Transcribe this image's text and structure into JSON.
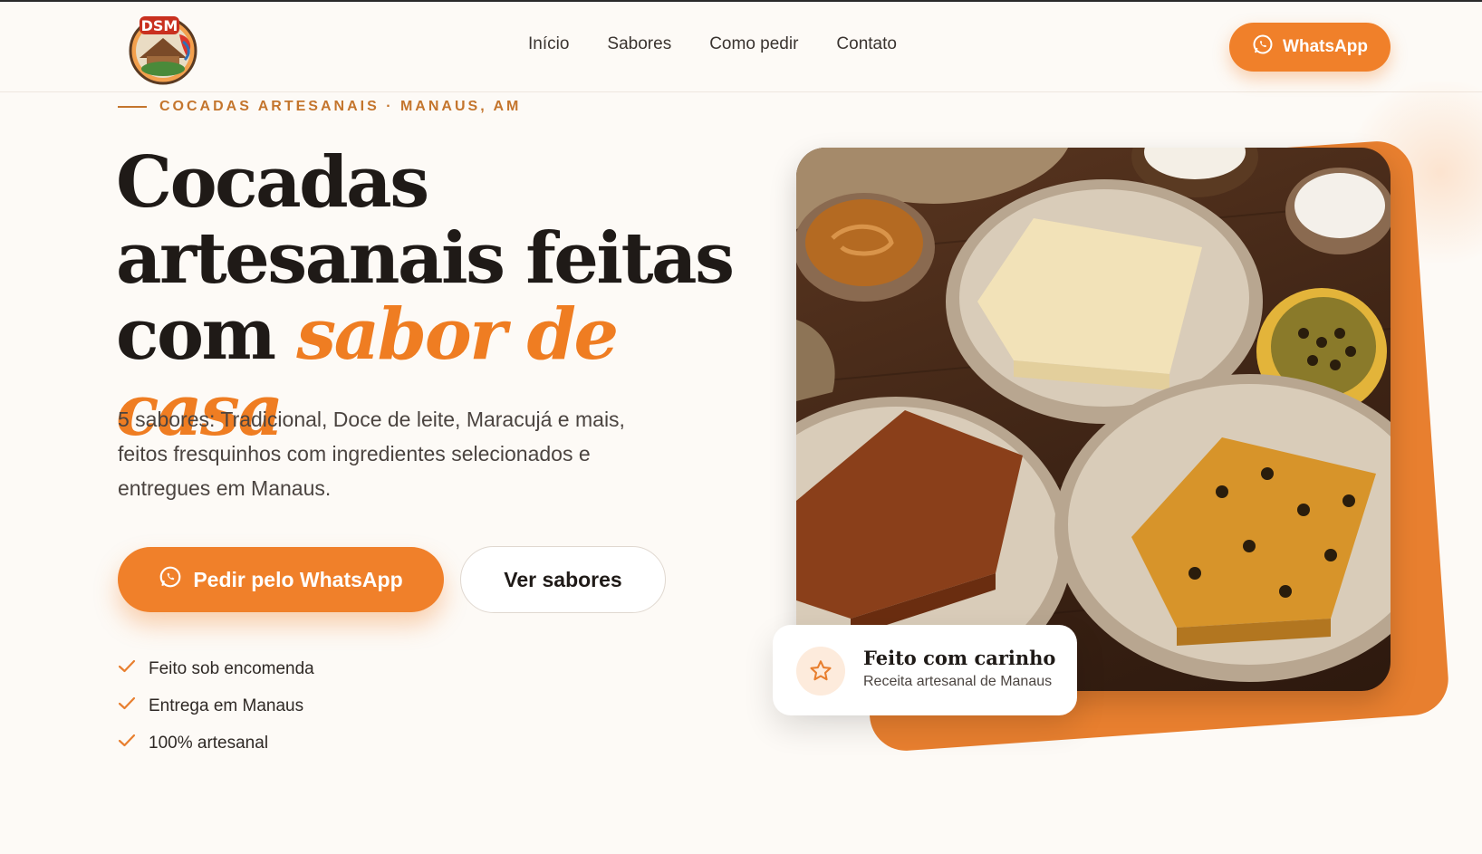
{
  "header": {
    "logo_text": "DSM",
    "nav": [
      {
        "label": "Início"
      },
      {
        "label": "Sabores"
      },
      {
        "label": "Como pedir"
      },
      {
        "label": "Contato"
      }
    ],
    "whatsapp_label": "WhatsApp"
  },
  "hero": {
    "eyebrow": "COCADAS ARTESANAIS · MANAUS, AM",
    "headline_line1": "Cocadas",
    "headline_line2": "artesanais feitas",
    "headline_line3_plain": "com",
    "headline_line3_accent": "sabor de casa",
    "subtitle": "5 sabores: Tradicional, Doce de leite, Maracujá e mais, feitos fresquinhos com ingredientes selecionados e entregues em Manaus.",
    "primary_button": "Pedir pelo WhatsApp",
    "secondary_button": "Ver sabores",
    "checks": [
      {
        "label": "Feito sob encomenda"
      },
      {
        "label": "Entrega em Manaus"
      },
      {
        "label": "100% artesanal"
      }
    ]
  },
  "badge": {
    "title": "Feito com carinho",
    "subtitle": "Receita artesanal de Manaus"
  },
  "colors": {
    "accent": "#f0802a",
    "dark": "#1f1a17",
    "background": "#fdfaf6"
  }
}
